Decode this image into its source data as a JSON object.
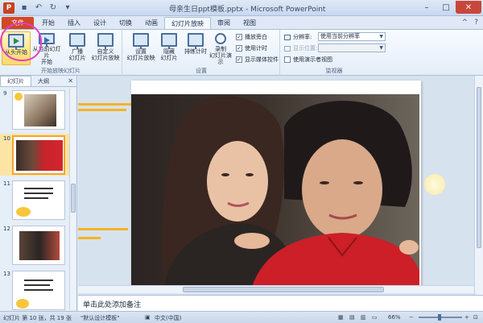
{
  "window": {
    "title": "母亲生日ppt模板.pptx - Microsoft PowerPoint",
    "app_icon": "P"
  },
  "tabs": [
    {
      "label": "文件"
    },
    {
      "label": "开始"
    },
    {
      "label": "插入"
    },
    {
      "label": "设计"
    },
    {
      "label": "切换"
    },
    {
      "label": "动画"
    },
    {
      "label": "幻灯片放映"
    },
    {
      "label": "审阅"
    },
    {
      "label": "视图"
    }
  ],
  "ribbon": {
    "group_start": {
      "label": "开始放映幻灯片",
      "from_beginning": "从头开始",
      "from_current": "从当前幻灯片\n开始",
      "broadcast": "广播\n幻灯片",
      "custom": "自定义\n幻灯片放映"
    },
    "group_setup": {
      "label": "设置",
      "setup_show": "设置\n幻灯片放映",
      "hide_slide": "隐藏\n幻灯片",
      "rehearse": "排练计时",
      "record": "录制\n幻灯片演示",
      "play_narration": "播放旁白",
      "use_timings": "使用计时",
      "show_media_controls": "显示媒体控件"
    },
    "group_monitors": {
      "label": "监视器",
      "resolution_label": "分辨率:",
      "resolution_value": "使用当前分辨率",
      "show_on_label": "显示位置:",
      "presenter_view": "使用演示者视图"
    }
  },
  "left_pane": {
    "tab_slides": "幻灯片",
    "tab_outline": "大纲",
    "slides": [
      "9",
      "10",
      "11",
      "12",
      "13"
    ],
    "selected": "10"
  },
  "notes": {
    "placeholder": "单击此处添加备注"
  },
  "status": {
    "slide_info": "幻灯片 第 10 张，共 19 张",
    "theme": "\"默认设计模板\"",
    "language": "中文(中国)",
    "zoom": "66%"
  },
  "colors": {
    "file_tab": "#d24726",
    "accent_stripe": "#f6b322",
    "highlight": "#ffd86a",
    "annotation": "#e040c8"
  }
}
